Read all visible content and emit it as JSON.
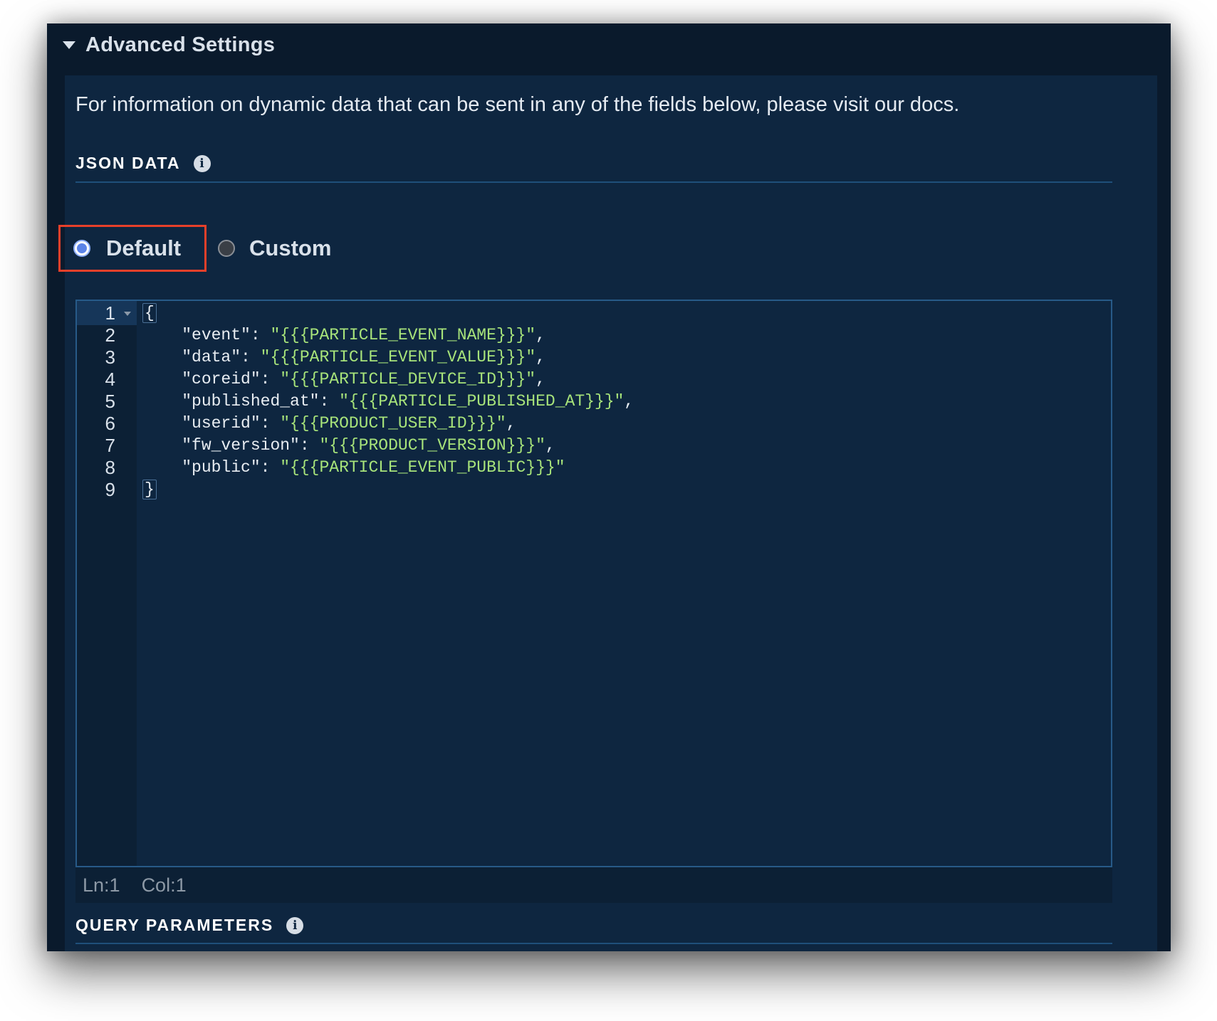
{
  "section": {
    "title": "Advanced Settings"
  },
  "info_text": "For information on dynamic data that can be sent in any of the fields below, please visit our docs.",
  "json_data": {
    "label": "JSON DATA",
    "info_icon": "info-icon",
    "options": [
      {
        "label": "Default",
        "selected": true
      },
      {
        "label": "Custom",
        "selected": false
      }
    ]
  },
  "editor": {
    "lines": [
      {
        "num": "1",
        "open": "{"
      },
      {
        "num": "2",
        "key": "\"event\"",
        "value": "\"{{{PARTICLE_EVENT_NAME}}}\"",
        "tail": ","
      },
      {
        "num": "3",
        "key": "\"data\"",
        "value": "\"{{{PARTICLE_EVENT_VALUE}}}\"",
        "tail": ","
      },
      {
        "num": "4",
        "key": "\"coreid\"",
        "value": "\"{{{PARTICLE_DEVICE_ID}}}\"",
        "tail": ","
      },
      {
        "num": "5",
        "key": "\"published_at\"",
        "value": "\"{{{PARTICLE_PUBLISHED_AT}}}\"",
        "tail": ","
      },
      {
        "num": "6",
        "key": "\"userid\"",
        "value": "\"{{{PRODUCT_USER_ID}}}\"",
        "tail": ","
      },
      {
        "num": "7",
        "key": "\"fw_version\"",
        "value": "\"{{{PRODUCT_VERSION}}}\"",
        "tail": ","
      },
      {
        "num": "8",
        "key": "\"public\"",
        "value": "\"{{{PARTICLE_EVENT_PUBLIC}}}\"",
        "tail": ""
      },
      {
        "num": "9",
        "close": "}"
      }
    ],
    "status": {
      "ln": "Ln:1",
      "col": "Col:1"
    }
  },
  "query_parameters": {
    "label": "QUERY PARAMETERS",
    "info_icon": "info-icon"
  },
  "colors": {
    "background": "#0a1a2c",
    "panel": "#0e2640",
    "string": "#a7e37a",
    "highlight_border": "#e8402a"
  }
}
